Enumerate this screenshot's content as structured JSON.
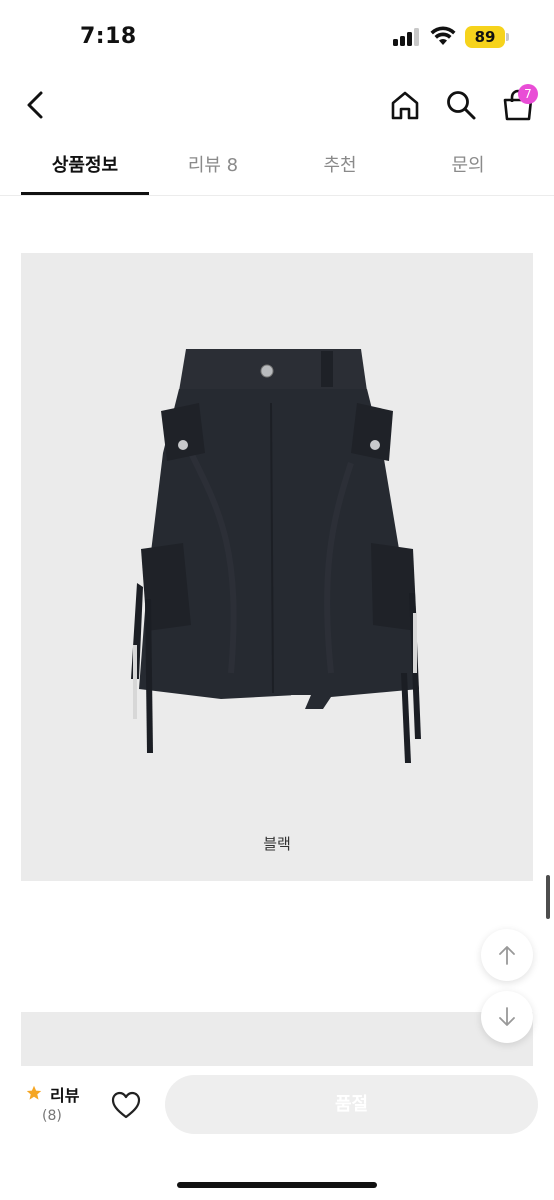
{
  "status_bar": {
    "time": "7:18",
    "battery_level": "89",
    "battery_color": "#f6d31c"
  },
  "nav": {
    "back_icon": "chevron-left-icon",
    "home_icon": "home-icon",
    "search_icon": "search-icon",
    "cart_icon": "shopping-bag-icon",
    "cart_count": "7",
    "badge_color": "#e94dd6"
  },
  "tabs": [
    {
      "label": "상품정보",
      "active": true
    },
    {
      "label": "리뷰 8",
      "active": false
    },
    {
      "label": "추천",
      "active": false
    },
    {
      "label": "문의",
      "active": false
    }
  ],
  "product": {
    "image": "black-cargo-skirt",
    "color_label": "블랙"
  },
  "floating": {
    "up_icon": "arrow-up-icon",
    "down_icon": "arrow-down-icon"
  },
  "bottom_bar": {
    "review_label": "리뷰",
    "review_count": "(8)",
    "star_color": "#f5a623",
    "heart_icon": "heart-icon",
    "buy_button": "품절"
  }
}
